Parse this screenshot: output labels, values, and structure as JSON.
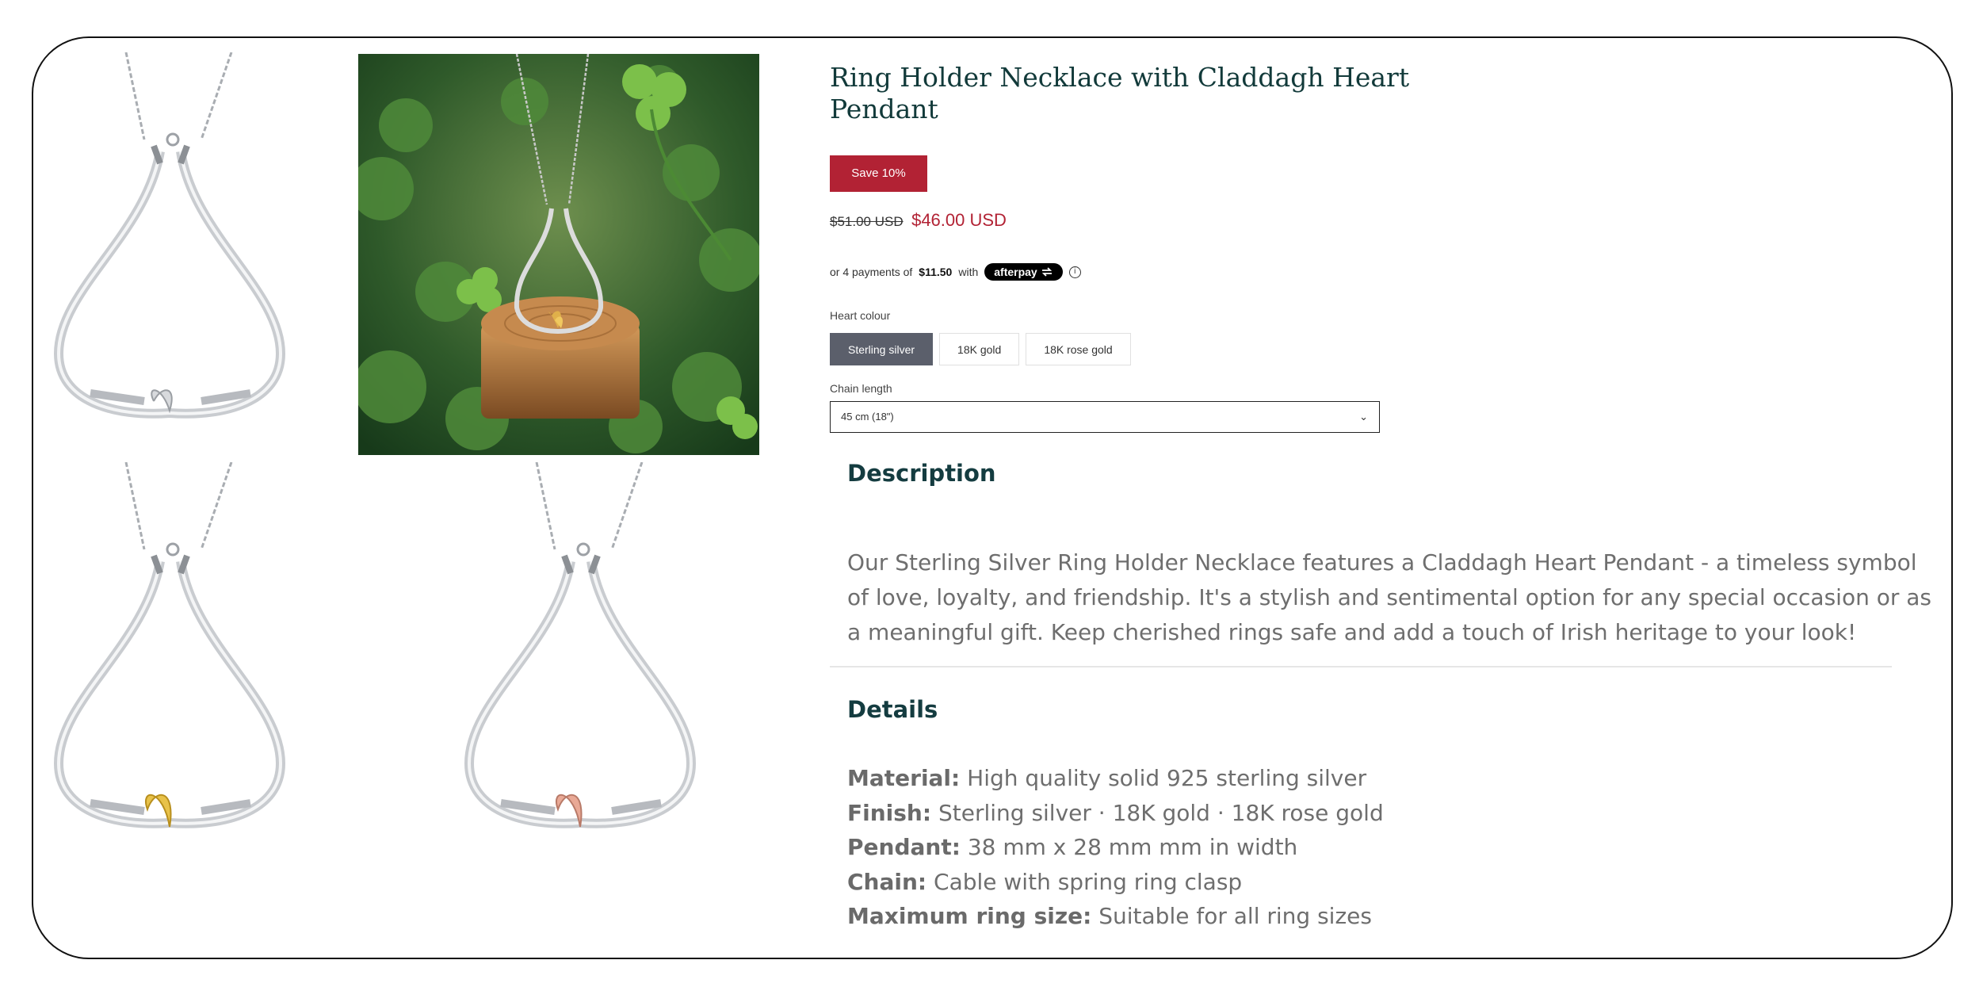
{
  "product": {
    "title": "Ring Holder Necklace with Claddagh Heart Pendant",
    "badge": "Save 10%",
    "price_old": "$51.00 USD",
    "price_new": "$46.00 USD"
  },
  "afterpay": {
    "prefix": "or 4 payments of",
    "amount": "$11.50",
    "with": "with",
    "brand": "afterpay",
    "info_glyph": "i"
  },
  "heart_colour": {
    "label": "Heart colour",
    "options": [
      "Sterling silver",
      "18K gold",
      "18K rose gold"
    ],
    "selected": "Sterling silver"
  },
  "chain_length": {
    "label": "Chain length",
    "value": "45 cm (18\")",
    "chevron": "⌄"
  },
  "description": {
    "heading": "Description",
    "body": "Our Sterling Silver Ring Holder Necklace features a Claddagh Heart Pendant - a timeless symbol of love, loyalty, and friendship. It's a stylish and sentimental option for any special occasion or as a meaningful gift. Keep cherished rings safe and add a touch of Irish heritage to your look!"
  },
  "details": {
    "heading": "Details",
    "items": [
      {
        "key": "Material:",
        "value": "High quality solid 925 sterling silver"
      },
      {
        "key": "Finish:",
        "value": "Sterling silver · 18K gold · 18K rose gold"
      },
      {
        "key": "Pendant:",
        "value": "38 mm x 28 mm mm in width"
      },
      {
        "key": "Chain:",
        "value": "Cable with spring ring clasp"
      },
      {
        "key": "Maximum ring size:",
        "value": "Suitable for all ring sizes"
      }
    ]
  },
  "colors": {
    "brand_red": "#b22234",
    "title_teal": "#123a3a",
    "selected_option": "#5b5f6b",
    "heart_silver": "#d8dadd",
    "heart_gold": "#e8c24a",
    "heart_rose": "#e9a996"
  },
  "gallery": {
    "thumbnails": [
      "silver-heart-necklace-image",
      "gold-heart-necklace-image",
      "rose-gold-heart-necklace-image"
    ],
    "hero": "necklace-on-wood-clover-photo"
  }
}
